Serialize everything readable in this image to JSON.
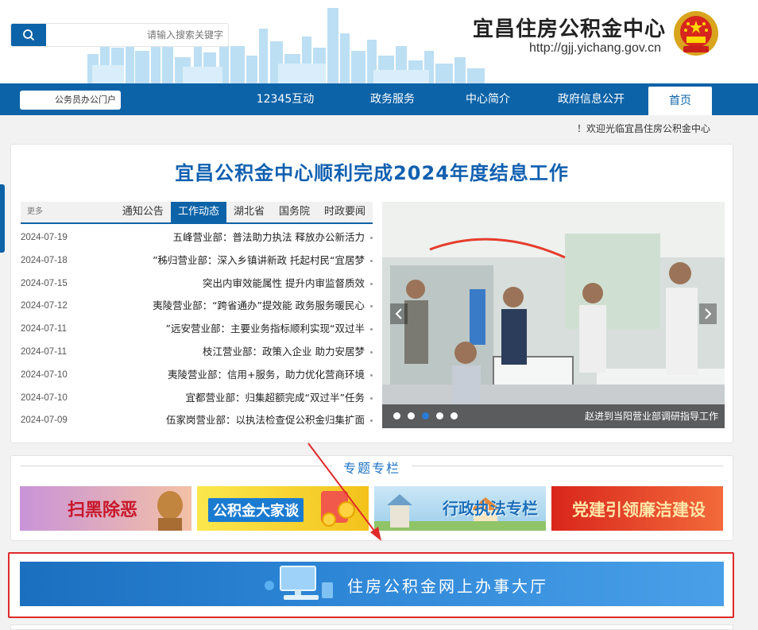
{
  "header": {
    "site_title": "宜昌住房公积金中心",
    "site_url": "http://gjj.yichang.gov.cn",
    "search_placeholder": "请输入搜索关键字"
  },
  "nav": {
    "items": [
      {
        "label": "首页",
        "active": true
      },
      {
        "label": "政府信息公开"
      },
      {
        "label": "中心简介"
      },
      {
        "label": "政务服务"
      },
      {
        "label": "12345互动"
      }
    ],
    "staff_login": "公务员办公门户"
  },
  "welcome": "欢迎光临宜昌住房公积金中心！",
  "news": {
    "headline": "宜昌公积金中心顺利完成2024年度结息工作",
    "tabs": [
      {
        "label": "时政要闻"
      },
      {
        "label": "国务院"
      },
      {
        "label": "湖北省"
      },
      {
        "label": "工作动态",
        "active": true
      },
      {
        "label": "通知公告"
      }
    ],
    "more": "更多",
    "items": [
      {
        "title": "五峰营业部：普法助力执法 释放办公新活力",
        "date": "2024-07-19"
      },
      {
        "title": "秭归营业部：深入乡镇讲新政 托起村民“宜居梦”",
        "date": "2024-07-18"
      },
      {
        "title": "突出内审效能属性 提升内审监督质效",
        "date": "2024-07-15"
      },
      {
        "title": "夷陵营业部：“跨省通办”提效能 政务服务暖民心",
        "date": "2024-07-12"
      },
      {
        "title": "远安营业部：主要业务指标顺利实现“双过半”",
        "date": "2024-07-11"
      },
      {
        "title": "枝江营业部：政策入企业 助力安居梦",
        "date": "2024-07-11"
      },
      {
        "title": "夷陵营业部：信用+服务，助力优化营商环境",
        "date": "2024-07-10"
      },
      {
        "title": "宜都营业部：归集超额完成“双过半”任务",
        "date": "2024-07-10"
      },
      {
        "title": "伍家岗营业部：以执法检查促公积金归集扩面",
        "date": "2024-07-09"
      }
    ],
    "carousel_caption": "赵进到当阳营业部调研指导工作",
    "carousel_active_index": 2,
    "carousel_dot_count": 5
  },
  "special": {
    "title": "专题专栏",
    "banners": [
      {
        "label": "党建引领廉洁建设"
      },
      {
        "label": "行政执法专栏"
      },
      {
        "label": "公积金大家谈"
      },
      {
        "label": "扫黑除恶"
      }
    ]
  },
  "hall_banner": {
    "label": "住房公积金网上办事大厅"
  },
  "colors": {
    "brand_blue": "#0c63a8",
    "headline_blue": "#1160b0",
    "highlight_red": "#e02a2a"
  }
}
